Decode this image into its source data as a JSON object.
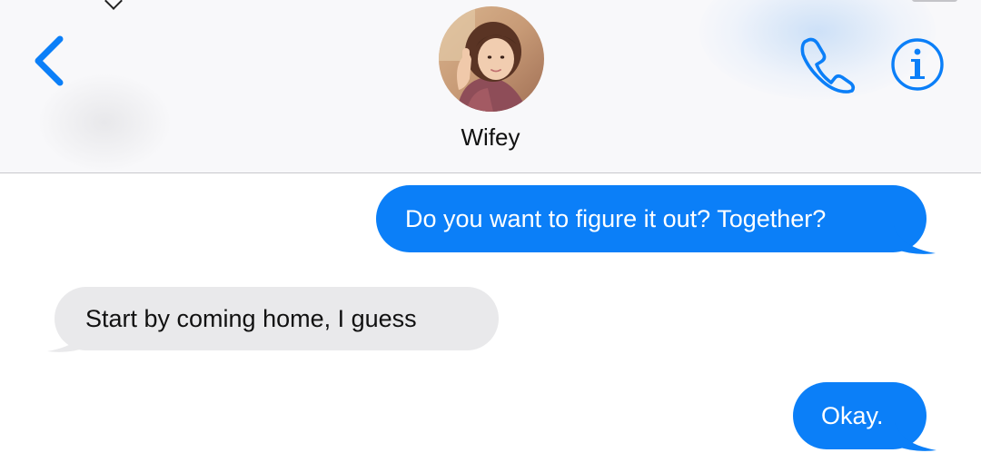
{
  "header": {
    "contact_name": "Wifey",
    "back_icon": "chevron-left-icon",
    "call_icon": "phone-icon",
    "info_icon": "info-icon"
  },
  "messages": [
    {
      "direction": "sent",
      "text": "Do you want to figure it out? Together?"
    },
    {
      "direction": "received",
      "text": "Start by coming home, I guess"
    },
    {
      "direction": "sent",
      "text": "Okay."
    }
  ],
  "colors": {
    "accent": "#0b7ff8",
    "sent_bubble": "#0b7ff8",
    "received_bubble": "#e9e9eb",
    "header_bg": "#f8f8fa"
  }
}
